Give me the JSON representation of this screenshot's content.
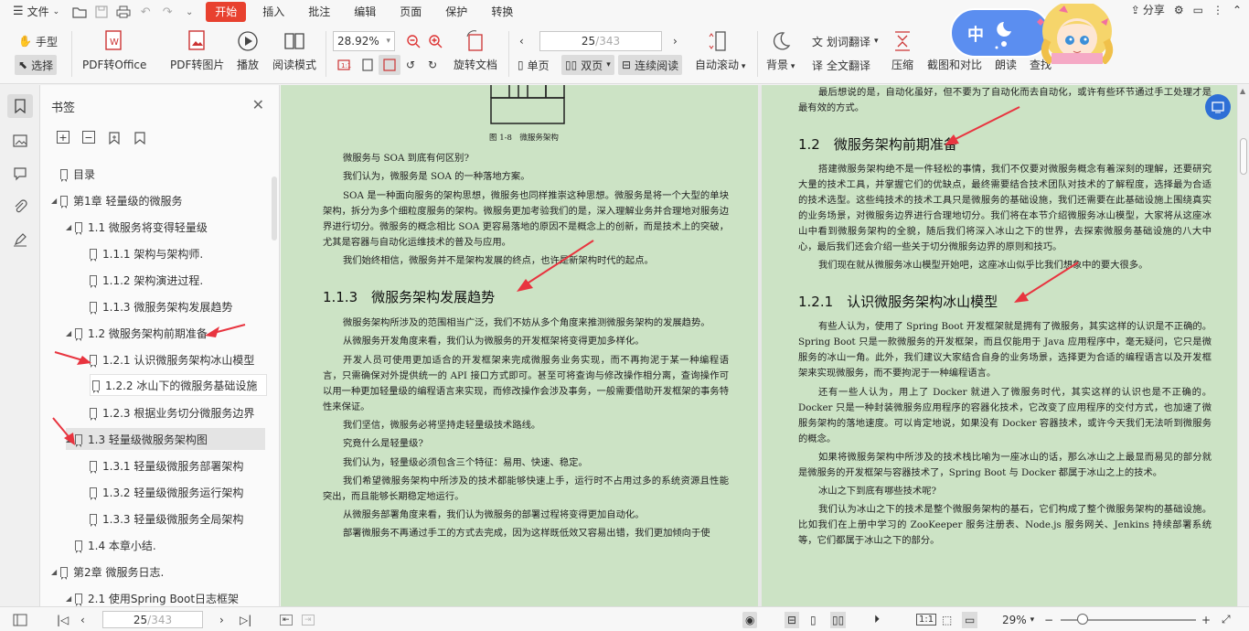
{
  "menu": {
    "file": "文件",
    "items": [
      "开始",
      "插入",
      "批注",
      "编辑",
      "页面",
      "保护",
      "转换"
    ],
    "share": "分享"
  },
  "toolbar": {
    "hand": "手型",
    "select": "选择",
    "pdf_office": "PDF转Office",
    "pdf_image": "PDF转图片",
    "play": "播放",
    "read_mode": "阅读模式",
    "zoom": "28.92%",
    "rotate": "旋转文档",
    "page_num": "25",
    "page_total": "/343",
    "single": "单页",
    "double": "双页",
    "continuous": "连续阅读",
    "auto_scroll": "自动滚动",
    "background": "背景",
    "word_translate": "划词翻译",
    "full_translate": "全文翻译",
    "compress": "压缩",
    "screenshot": "截图和对比",
    "read_aloud": "朗读",
    "find": "查找"
  },
  "mascot": {
    "char": "中"
  },
  "panel": {
    "title": "书签",
    "items": [
      {
        "label": "目录"
      },
      {
        "label": "第1章 轻量级的微服务"
      },
      {
        "label": "1.1 微服务将变得轻量级"
      },
      {
        "label": "1.1.1 架构与架构师."
      },
      {
        "label": "1.1.2 架构演进过程."
      },
      {
        "label": "1.1.3 微服务架构发展趋势"
      },
      {
        "label": "1.2 微服务架构前期准备"
      },
      {
        "label": "1.2.1 认识微服务架构冰山模型"
      },
      {
        "label": "1.2.2 冰山下的微服务基础设施"
      },
      {
        "label": "1.2.3 根据业务切分微服务边界"
      },
      {
        "label": "1.3 轻量级微服务架构图"
      },
      {
        "label": "1.3.1 轻量级微服务部署架构"
      },
      {
        "label": "1.3.2 轻量级微服务运行架构"
      },
      {
        "label": "1.3.3 轻量级微服务全局架构"
      },
      {
        "label": "1.4 本章小结."
      },
      {
        "label": "第2章 微服务日志."
      },
      {
        "label": "2.1 使用Spring Boot日志框架"
      }
    ]
  },
  "doc": {
    "left": {
      "fig_caption": "图 1-8　微服务架构",
      "p1": "微服务与 SOA 到底有何区别?",
      "p2": "我们认为，微服务是 SOA 的一种落地方案。",
      "p3": "SOA 是一种面向服务的架构思想，微服务也同样推崇这种思想。微服务是将一个大型的单块架构，拆分为多个细粒度服务的架构。微服务更加考验我们的是，深入理解业务并合理地对服务边界进行切分。微服务的概念相比 SOA 更容易落地的原因不是概念上的创新，而是技术上的突破，尤其是容器与自动化运维技术的普及与应用。",
      "p4": "我们始终相信，微服务并不是架构发展的终点，也许是新架构时代的起点。",
      "h": "1.1.3　微服务架构发展趋势",
      "p5": "微服务架构所涉及的范围相当广泛，我们不妨从多个角度来推测微服务架构的发展趋势。",
      "p6": "从微服务开发角度来看，我们认为微服务的开发框架将变得更加多样化。",
      "p7": "开发人员可使用更加适合的开发框架来完成微服务业务实现，而不再拘泥于某一种编程语言，只需确保对外提供统一的 API 接口方式即可。甚至可将查询与修改操作相分离，查询操作可以用一种更加轻量级的编程语言来实现，而修改操作会涉及事务，一般需要借助开发框架的事务特性来保证。",
      "p8": "我们坚信，微服务必将坚持走轻量级技术路线。",
      "p9": "究竟什么是轻量级?",
      "p10": "我们认为，轻量级必须包含三个特征：易用、快速、稳定。",
      "p11": "我们希望微服务架构中所涉及的技术都能够快速上手，运行时不占用过多的系统资源且性能突出，而且能够长期稳定地运行。",
      "p12": "从微服务部署角度来看，我们认为微服务的部署过程将变得更加自动化。",
      "p13": "部署微服务不再通过手工的方式去完成，因为这样既低效又容易出错，我们更加倾向于使"
    },
    "right": {
      "p0": "最后想说的是，自动化虽好，但不要为了自动化而去自动化，或许有些环节通过手工处理才是最有效的方式。",
      "h1": "1.2　微服务架构前期准备",
      "p1": "搭建微服务架构绝不是一件轻松的事情，我们不仅要对微服务概念有着深刻的理解，还要研究大量的技术工具，并掌握它们的优缺点，最终需要结合技术团队对技术的了解程度，选择最为合适的技术选型。这些纯技术的技术工具只是微服务的基础设施，我们还需要在此基础设施上围绕真实的业务场景，对微服务边界进行合理地切分。我们将在本节介绍微服务冰山模型，大家将从这座冰山中看到微服务架构的全貌，随后我们将深入冰山之下的世界，去探索微服务基础设施的八大中心，最后我们还会介绍一些关于切分微服务边界的原则和技巧。",
      "p2": "我们现在就从微服务冰山模型开始吧，这座冰山似乎比我们想象中的要大很多。",
      "h2": "1.2.1　认识微服务架构冰山模型",
      "p3": "有些人认为，使用了 Spring Boot 开发框架就是拥有了微服务，其实这样的认识是不正确的。Spring Boot 只是一款微服务的开发框架，而且仅能用于 Java 应用程序中，毫无疑问，它只是微服务的冰山一角。此外，我们建议大家结合自身的业务场景，选择更为合适的编程语言以及开发框架来实现微服务，而不要拘泥于一种编程语言。",
      "p4": "还有一些人认为，用上了 Docker 就进入了微服务时代，其实这样的认识也是不正确的。Docker 只是一种封装微服务应用程序的容器化技术，它改变了应用程序的交付方式，也加速了微服务架构的落地速度。可以肯定地说，如果没有 Docker 容器技术，或许今天我们无法听到微服务的概念。",
      "p5": "如果将微服务架构中所涉及的技术栈比喻为一座冰山的话，那么冰山之上最显而易见的部分就是微服务的开发框架与容器技术了，Spring Boot 与 Docker 都属于冰山之上的技术。",
      "p6": "冰山之下到底有哪些技术呢?",
      "p7": "我们认为冰山之下的技术是整个微服务架构的基石，它们构成了整个微服务架构的基础设施。比如我们在上册中学习的 ZooKeeper 服务注册表、Node.js 服务网关、Jenkins 持续部署系统等，它们都属于冰山之下的部分。"
    }
  },
  "status": {
    "page_num": "25",
    "page_total": "/343",
    "zoom": "29%"
  },
  "colors": {
    "accent": "#e8412f",
    "page_bg": "#cce3c5",
    "arrow": "#e8343f",
    "blue": "#2e6fd6"
  }
}
